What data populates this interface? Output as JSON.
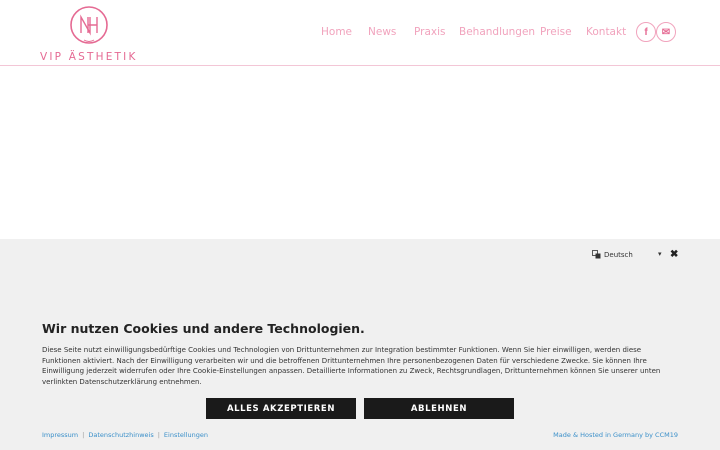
{
  "brand": {
    "name": "VIP ÄSTHETIK",
    "accent": "#e56a93",
    "nav_color": "#f1a3bd"
  },
  "nav": {
    "items": [
      "Home",
      "News",
      "Praxis",
      "Behandlungen",
      "Preise",
      "Kontakt"
    ]
  },
  "social": [
    {
      "icon": "facebook-icon",
      "glyph": "f"
    },
    {
      "icon": "mail-icon",
      "glyph": "✉"
    }
  ],
  "cookie": {
    "language": {
      "selected": "Deutsch"
    },
    "title": "Wir nutzen Cookies und andere Technologien.",
    "text": "Diese Seite nutzt einwilligungsbedürftige Cookies und Technologien von Drittunternehmen zur Integration bestimmter Funktionen. Wenn Sie hier einwilligen, werden diese Funktionen aktiviert. Nach der Einwilligung verarbeiten wir und die betroffenen Drittunternehmen Ihre personenbezogenen Daten für verschiedene Zwecke. Sie können Ihre Einwilligung jederzeit widerrufen oder Ihre Cookie-Einstellungen anpassen. Detaillierte Informationen zu Zweck, Rechtsgrundlagen, Drittunternehmen können Sie unserer unten verlinkten Datenschutzerklärung entnehmen.",
    "accept_label": "ALLES AKZEPTIEREN",
    "decline_label": "ABLEHNEN",
    "footer_links": [
      "Impressum",
      "Datenschutzhinweis",
      "Einstellungen"
    ],
    "made_by": "Made & Hosted in Germany by CCM19"
  }
}
